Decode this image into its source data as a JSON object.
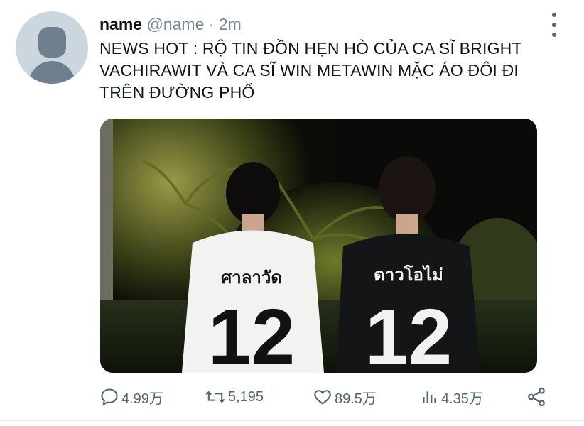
{
  "tweet": {
    "name": "name",
    "handle": "@name",
    "separator": "·",
    "time": "2m",
    "text": "NEWS HOT : RỘ TIN ĐỒN HẸN HÒ CỦA CA SĨ BRIGHT VACHIRAWIT VÀ CA SĨ WIN METAWIN MẶC ÁO ĐÔI ĐI TRÊN ĐƯỜNG PHỐ",
    "media": {
      "left_jersey_name": "ศาลาวัด",
      "left_jersey_number": "12",
      "right_jersey_name": "ดาวโอไม่",
      "right_jersey_number": "12",
      "left_jersey_color": "#f4f4f2",
      "right_jersey_color": "#111214"
    }
  },
  "actions": {
    "replies": "4.99万",
    "retweets": "5,195",
    "likes": "89.5万",
    "views": "4.35万"
  },
  "icons": {
    "more": "more-vertical-icon",
    "reply": "reply-icon",
    "retweet": "retweet-icon",
    "like": "heart-icon",
    "views": "views-icon",
    "share": "share-icon"
  },
  "colors": {
    "text": "#0f1419",
    "secondary": "#536471",
    "avatar_bg": "#cbd6df",
    "avatar_fg": "#6e7f8d"
  }
}
